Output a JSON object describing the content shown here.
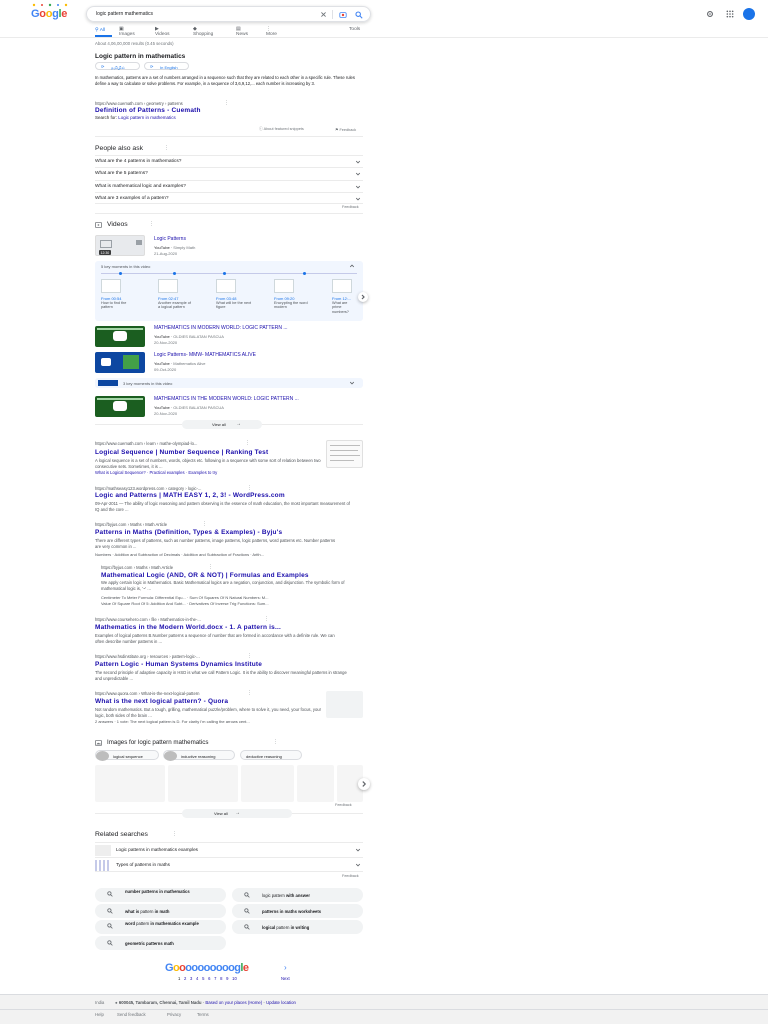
{
  "search": {
    "query": "logic pattern mathematics"
  },
  "tabs": [
    {
      "label": "All"
    },
    {
      "label": "Images"
    },
    {
      "label": "Videos"
    },
    {
      "label": "Shopping"
    },
    {
      "label": "News"
    },
    {
      "label": "More"
    }
  ],
  "tools_label": "Tools",
  "result_stats": "About 4,06,00,000 results (0.45 seconds)",
  "featured": {
    "heading": "Logic pattern in mathematics",
    "lang1": "தமிழில்",
    "lang2": "In English",
    "text": "In mathematics, patterns are a set of numbers arranged in a sequence such that they are related to each other in a specific rule. These rules define a way to calculate or solve problems. For example, in a sequence of 3,6,9,12,... each number is increasing by 3.",
    "url": "https://www.cuemath.com › geometry › patterns",
    "title": "Definition of Patterns - Cuemath",
    "search_for_prefix": "Search for:",
    "search_for_link": "Logic pattern in mathematics",
    "about": "About featured snippets",
    "feedback": "Feedback"
  },
  "paa": {
    "heading": "People also ask",
    "items": [
      "What are the 4 patterns in mathematics?",
      "What are the 5 patterns?",
      "What is mathematical logic and examples?",
      "What are 3 examples of a pattern?"
    ],
    "feedback": "Feedback"
  },
  "videos": {
    "heading": "Videos",
    "v1": {
      "title": "Logic Patterns",
      "source": "YouTube",
      "channel": "Simply Math",
      "date": "21-Aug-2020",
      "duration": "12:30"
    },
    "key_moments": "5 key moments in this video",
    "moments": [
      {
        "from": "From 00:54",
        "desc": "How to find the pattern"
      },
      {
        "from": "From 02:47",
        "desc": "Another example of a logical pattern"
      },
      {
        "from": "From 03:48",
        "desc": "What will be the next figure"
      },
      {
        "from": "From 09:20",
        "desc": "Encrypting the word modern"
      },
      {
        "from": "From 12:...",
        "desc": "What are prime numbers?"
      }
    ],
    "v2": {
      "title": "MATHEMATICS IN MODERN WORLD: LOGIC PATTERN ...",
      "source": "YouTube",
      "channel": "OLDIES BALATAN PASCUA",
      "date": "20-Nov-2020"
    },
    "v3": {
      "title": "Logic Patterns- MMW- MATHEMATICS ALIVE",
      "source": "YouTube",
      "channel": "Mathematics Alive",
      "date": "09-Oct-2020"
    },
    "key_moments2": "3 key moments in this video",
    "v4": {
      "title": "MATHEMATICS IN THE MODERN WORLD: LOGIC PATTERN ...",
      "source": "YouTube",
      "channel": "OLDIES BALATAN PASCUA",
      "date": "20-Nov-2020"
    },
    "view_all": "View all"
  },
  "results": [
    {
      "url": "https://www.cuemath.com › learn › mathe-olympiad-lo...",
      "title": "Logical Sequence | Number Sequence | Ranking Test",
      "snippet": "A logical sequence is a set of numbers, words, objects etc. following in a sequence with some sort of relation between two consecutive sets. Sometimes, it is ...",
      "links": "What is Logical Sequence? · Practical examples · Examples to try"
    },
    {
      "url": "https://mathseasy123.wordpress.com › category › logic-...",
      "title": "Logic and Patterns | MATH EASY 1, 2, 3! - WordPress.com",
      "snippet": "09-Apr-2011 — The ability of logic reasoning and pattern observing is the essence of math education, the most important measurement of IQ and the core ..."
    },
    {
      "url": "https://byjus.com › Maths › Math Article",
      "title": "Patterns in Maths (Definition, Types & Examples) - Byju's",
      "snippet": "There are different types of patterns, such as number patterns, image patterns, logic patterns, word patterns etc. Number patterns are very common in ...",
      "links": "Numbers · Addition and Subtraction of Decimals · Addition and Subtraction of Fractions · Arith..."
    },
    {
      "url": "https://byjus.com › Maths › Math Article",
      "title": "Mathematical Logic (AND, OR & NOT) | Formulas and Examples",
      "snippet": "We apply certain logic in Mathematics. Basic Mathematical logics are a negation, conjunction, and disjunction. The symbolic form of mathematical logic is, '~' ...",
      "links1": "Centimeter To Meter Formula: Differential Equ... · Sum Of Squares Of N Natural Numbers: M...",
      "links2": "Value Of Square Root Of 5: Addition And Subt... · Derivatives Of Inverse Trig Functions: Sum..."
    },
    {
      "url": "https://www.coursehero.com › file › Mathematics-in-the-...",
      "title": "Mathematics in the Modern World.docx - 1. A pattern is...",
      "snippet": "Examples of logical patterns B.Number patterns a sequence of number that are formed in accordance with a definite rule. We can often describe number patterns in ..."
    },
    {
      "url": "https://www.hsdinstitute.org › resources › pattern-logic-...",
      "title": "Pattern Logic - Human Systems Dynamics Institute",
      "snippet": "The second principle of adaptive capacity in HSD is what we call Pattern Logic. It is the ability to discover meaningful patterns in strange and unpredictable ..."
    },
    {
      "url": "https://www.quora.com › What-is-the-next-logical-pattern",
      "title": "What is the next logical pattern? - Quora",
      "snippet": "Not random mathematics. But a tough, grilling, mathematical puzzle/problem, where to solve it, you need, your focus, your logic, both sides of the brain ...",
      "answers": "2 answers · 1 vote: The next logical pattern is D. For clarity I'm calling the arrows cent..."
    }
  ],
  "images": {
    "heading": "Images for logic pattern mathematics",
    "chips": [
      "logical sequence",
      "inductive reasoning",
      "deductive reasoning"
    ],
    "feedback": "Feedback",
    "view_all": "View all"
  },
  "related": {
    "heading": "Related searches",
    "expand": [
      "Logic patterns in mathematics examples",
      "Types of patterns in maths"
    ],
    "feedback": "Feedback",
    "chips": [
      {
        "pre": "",
        "bold": "number patterns in mathematics",
        "post": ""
      },
      {
        "pre": "logic pattern ",
        "bold": "with answer",
        "post": ""
      },
      {
        "pre": "",
        "bold": "what is",
        "post": " pattern ",
        "bold2": "in math"
      },
      {
        "pre": "",
        "bold": "patterns in maths worksheets",
        "post": ""
      },
      {
        "pre": "",
        "bold": "word",
        "post": " pattern ",
        "bold2": "in mathematics example"
      },
      {
        "pre": "",
        "bold": "logical",
        "post": " pattern ",
        "bold2": "in writing"
      },
      {
        "pre": "",
        "bold": "geometric patterns math",
        "post": ""
      }
    ]
  },
  "pagination": {
    "pages": [
      "1",
      "2",
      "3",
      "4",
      "5",
      "6",
      "7",
      "8",
      "9",
      "10"
    ],
    "next": "Next"
  },
  "footer": {
    "country": "India",
    "location": "600045, Tambaram, Chennai, Tamil Nadu",
    "based_on": "Based on your places (Home)",
    "update": "Update location",
    "links": [
      "Help",
      "Send feedback",
      "Privacy",
      "Terms"
    ]
  },
  "colors": {
    "link": "#1a0dab",
    "accent": "#1a73e8",
    "text": "#202124",
    "muted": "#70757a"
  }
}
